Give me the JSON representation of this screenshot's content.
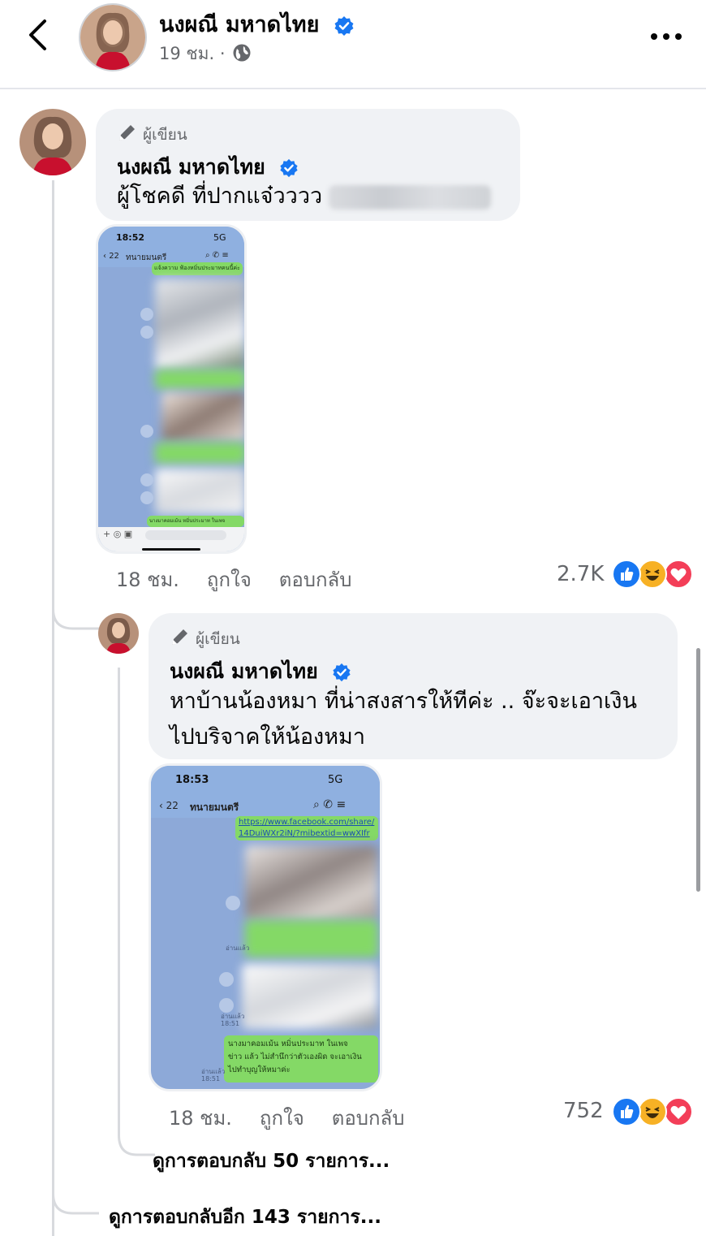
{
  "header": {
    "name": "นงผณี มหาดไทย",
    "time": "19 ชม. ·"
  },
  "comment1": {
    "author_label": "ผู้เขียน",
    "name": "นงผณี มหาดไทย",
    "text": "ผู้โชคดี ที่ปากแจ๋วววว",
    "screenshot": {
      "time": "18:52",
      "signal": "5G",
      "back_count": "22",
      "chat_name": "ทนายมนตรี",
      "bubble_top": "แจ้งความ ฟ้องหมิ่นประมาทคนนี้ค่ะ",
      "bubble_bottom": "นางมาคอมเม้น หมิ่นประมาท ในเพจ"
    },
    "timestamp": "18 ชม.",
    "like_label": "ถูกใจ",
    "reply_label": "ตอบกลับ",
    "reaction_count": "2.7K"
  },
  "reply1": {
    "author_label": "ผู้เขียน",
    "name": "นงผณี มหาดไทย",
    "text_line1": "หาบ้านน้องหมา ที่น่าสงสารให้ทีค่ะ .. จ๊ะจะเอาเงิน",
    "text_line2": "ไปบริจาคให้น้องหมา",
    "screenshot": {
      "time": "18:53",
      "signal": "5G",
      "back_count": "22",
      "chat_name": "ทนายมนตรี",
      "link_text_1": "https://www.facebook.com/share/",
      "link_text_2": "14DuiWXr2iN/?mibextid=wwXIfr",
      "read_label_1": "อ่านแล้ว",
      "read_time_1": "18:51",
      "read_label_2": "อ่านแล้ว",
      "read_time_2": "18:51",
      "bubble_bottom_1": "นางมาคอมเม้น หมิ่นประมาท ในเพจ",
      "bubble_bottom_2": "ข่าว แล้ว ไม่สำนึกว่าตัวเองผิด จะเอาเงิน",
      "bubble_bottom_3": "ไปทำบุญให้หมาค่ะ",
      "read_label_3": "อ่านแล้ว",
      "read_time_3": "18:51"
    },
    "timestamp": "18 ชม.",
    "like_label": "ถูกใจ",
    "reply_label": "ตอบกลับ",
    "reaction_count": "752"
  },
  "view_replies_nested": "ดูการตอบกลับ 50 รายการ...",
  "view_replies_more": "ดูการตอบกลับอีก 143 รายการ...",
  "colors": {
    "accent_blue": "#1877f2",
    "bubble_bg": "#f0f2f5",
    "secondary_text": "#65676b",
    "line_green": "#84d966",
    "chat_bg": "#8da9d8"
  },
  "icons": [
    "back-arrow-icon",
    "globe-icon",
    "more-icon",
    "verified-badge-icon",
    "pen-icon",
    "like-reaction-icon",
    "haha-reaction-icon",
    "love-reaction-icon"
  ]
}
